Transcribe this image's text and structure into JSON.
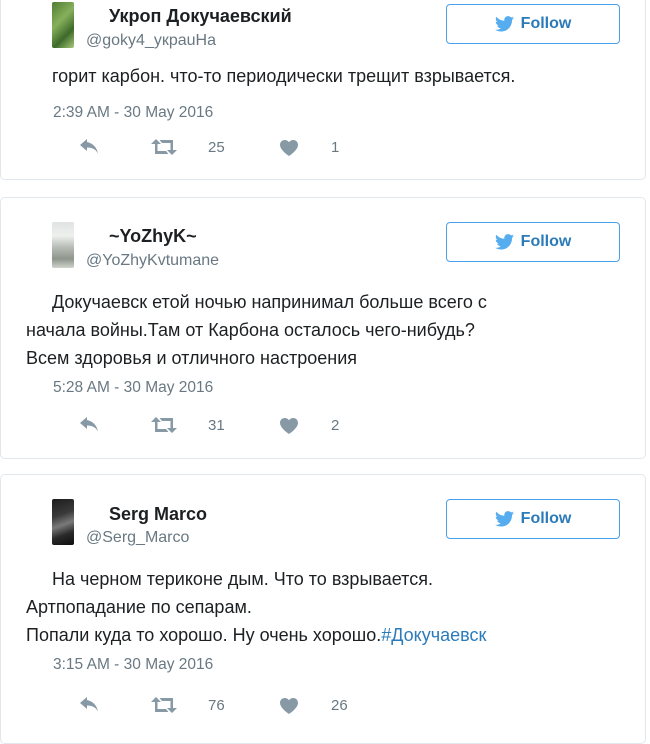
{
  "follow_label": "Follow",
  "icons": {
    "follow": "twitter-bird-icon",
    "reply": "reply-icon",
    "retweet": "retweet-icon",
    "like": "heart-icon"
  },
  "colors": {
    "accent": "#2b7bb9",
    "border": "#4aa1eb",
    "muted": "#697882",
    "icon": "#8899a6"
  },
  "tweets": [
    {
      "name": "Укроп Докучаевский",
      "handle": "@goky4_украuHa",
      "lines": [
        "горит карбон. что-то периодически трещит взрывается."
      ],
      "time": "2:39 AM - 30 May 2016",
      "retweets": "25",
      "likes": "1"
    },
    {
      "name": "~YoZhyK~",
      "handle": "@YoZhyKvtumane",
      "lines": [
        "Докучаевск етой ночью напринимал больше всего с",
        "начала войны.Там от Карбона осталось чего-нибудь?",
        "Всем здоровья и отличного настроения"
      ],
      "time": "5:28 AM - 30 May 2016",
      "retweets": "31",
      "likes": "2"
    },
    {
      "name": "Serg Marco",
      "handle": "@Serg_Marco",
      "lines": [
        "На черном териконе дым. Что то взрывается.",
        "Артпопадание по сепарам.",
        "Попали куда то хорошо. Ну очень хорошо."
      ],
      "hashtag": "#Докучаевск",
      "time": "3:15 AM - 30 May 2016",
      "retweets": "76",
      "likes": "26"
    }
  ]
}
